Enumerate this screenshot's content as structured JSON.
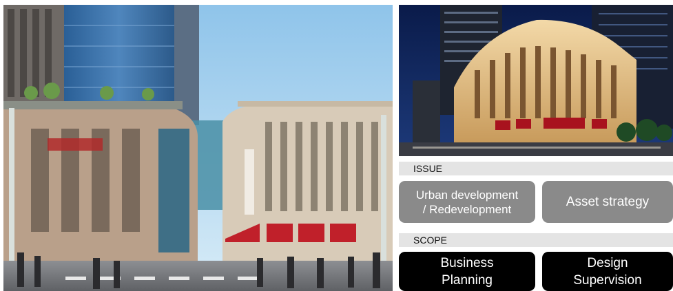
{
  "issue": {
    "heading": "ISSUE",
    "tiles": [
      "Urban development\n/ Redevelopment",
      "Asset strategy"
    ]
  },
  "scope": {
    "heading": "SCOPE",
    "tiles": [
      "Business\nPlanning",
      "Design\nSupervision"
    ]
  },
  "colors": {
    "section_bar": "#e4e4e4",
    "issue_tile": "#8a8a8a",
    "scope_tile": "#000000",
    "tile_text": "#ffffff"
  }
}
